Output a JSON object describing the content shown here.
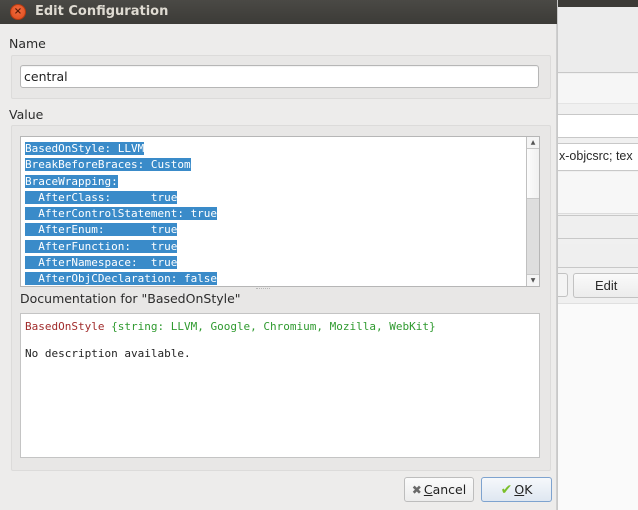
{
  "dialog": {
    "title": "Edit Configuration",
    "close_icon": "close-icon"
  },
  "name_section": {
    "label": "Name",
    "value": "central"
  },
  "value_section": {
    "label": "Value",
    "lines": [
      "BasedOnStyle: LLVM",
      "BreakBeforeBraces: Custom",
      "BraceWrapping:",
      "  AfterClass:      true",
      "  AfterControlStatement: true",
      "  AfterEnum:       true",
      "  AfterFunction:   true",
      "  AfterNamespace:  true",
      "  AfterObjCDeclaration: false"
    ],
    "selection_color": "#3a8bc9"
  },
  "documentation": {
    "label": "Documentation for \"BasedOnStyle\"",
    "key": "BasedOnStyle",
    "type_info": "{string: LLVM, Google, Chromium, Mozilla, WebKit}",
    "description": "No description available.",
    "key_color": "#a12c2c",
    "type_color": "#2f9a2f"
  },
  "buttons": {
    "cancel": {
      "mnemonic": "C",
      "rest": "ancel",
      "icon": "x-icon"
    },
    "ok": {
      "mnemonic": "O",
      "rest": "K",
      "icon": "checkmark-icon"
    }
  },
  "background_window": {
    "field_text": "x-objcsrc; tex",
    "edit_button": "Edit"
  }
}
